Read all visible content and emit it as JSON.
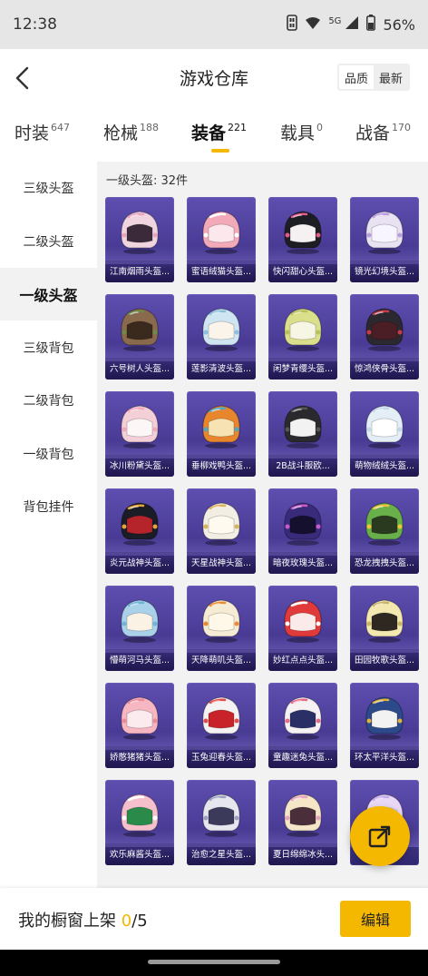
{
  "status_bar": {
    "time": "12:38",
    "network": "5G",
    "battery": "56%",
    "icons": [
      "sim-icon",
      "wifi-icon",
      "signal-icon",
      "battery-icon"
    ]
  },
  "nav": {
    "title": "游戏仓库",
    "sort_options": [
      "品质",
      "最新"
    ],
    "active_sort": "品质",
    "back_icon": "chevron-left-icon"
  },
  "tabs": [
    {
      "label": "时装",
      "count": "647"
    },
    {
      "label": "枪械",
      "count": "188"
    },
    {
      "label": "装备",
      "count": "221",
      "active": true
    },
    {
      "label": "载具",
      "count": "0"
    },
    {
      "label": "战备",
      "count": "170"
    }
  ],
  "sidebar": {
    "items": [
      "三级头盔",
      "二级头盔",
      "一级头盔",
      "三级背包",
      "二级背包",
      "一级背包",
      "背包挂件"
    ],
    "active_index": 2
  },
  "section": {
    "title": "一级头盔: 32件"
  },
  "items": [
    {
      "name": "江南烟雨头盔...",
      "colors": {
        "shell": "#f0d4e0",
        "visor": "#3b2a3a",
        "accent": "#e8a3c0"
      }
    },
    {
      "name": "蜜语绒猫头盔...",
      "colors": {
        "shell": "#f2a9b8",
        "visor": "#fbe7ec",
        "accent": "#ffffff"
      }
    },
    {
      "name": "快闪甜心头盔...",
      "colors": {
        "shell": "#1d1d24",
        "visor": "#f5f0f2",
        "accent": "#e45a8a"
      }
    },
    {
      "name": "镜光幻境头盔...",
      "colors": {
        "shell": "#e8e2f2",
        "visor": "#f7f5ff",
        "accent": "#b89be0"
      }
    },
    {
      "name": "六号树人头盔...",
      "colors": {
        "shell": "#8a6a4c",
        "visor": "#3a2a1e",
        "accent": "#6e8a4a"
      }
    },
    {
      "name": "莲影清波头盔...",
      "colors": {
        "shell": "#cfe6f2",
        "visor": "#fbf4ea",
        "accent": "#8cc0de"
      }
    },
    {
      "name": "闲梦青缨头盔...",
      "colors": {
        "shell": "#d9df8a",
        "visor": "#f7f6e4",
        "accent": "#b8c25c"
      }
    },
    {
      "name": "惊鸿侠骨头盔...",
      "colors": {
        "shell": "#2b2830",
        "visor": "#4a1e24",
        "accent": "#c83a4a"
      }
    },
    {
      "name": "冰川粉黛头盔...",
      "colors": {
        "shell": "#f3d0d8",
        "visor": "#fdf6f7",
        "accent": "#f0a9bd"
      }
    },
    {
      "name": "垂柳戏鸭头盔...",
      "colors": {
        "shell": "#e8862e",
        "visor": "#f6e2b2",
        "accent": "#4fa8c8"
      }
    },
    {
      "name": "2B战斗服欧...",
      "colors": {
        "shell": "#2a2a2e",
        "visor": "#f2f2f2",
        "accent": "#555"
      }
    },
    {
      "name": "萌物绒绒头盔...",
      "colors": {
        "shell": "#e4eef6",
        "visor": "#ffffff",
        "accent": "#c3d8ea"
      }
    },
    {
      "name": "炎元战神头盔...",
      "colors": {
        "shell": "#1a1d26",
        "visor": "#b5242a",
        "accent": "#e2a53a"
      }
    },
    {
      "name": "天星战神头盔...",
      "colors": {
        "shell": "#f3eee4",
        "visor": "#fffaf0",
        "accent": "#d9b25a"
      }
    },
    {
      "name": "暗夜玫瑰头盔...",
      "colors": {
        "shell": "#3a2a7a",
        "visor": "#15102e",
        "accent": "#c95ac8"
      }
    },
    {
      "name": "恐龙拽拽头盔...",
      "colors": {
        "shell": "#6ab04a",
        "visor": "#2a3a1e",
        "accent": "#f2c33a"
      }
    },
    {
      "name": "懵萌河马头盔...",
      "colors": {
        "shell": "#a9d2ea",
        "visor": "#fbf2e6",
        "accent": "#6fb3d8"
      }
    },
    {
      "name": "天降萌叽头盔...",
      "colors": {
        "shell": "#f6ecd6",
        "visor": "#fff8e8",
        "accent": "#ef8a2e"
      }
    },
    {
      "name": "妙红点点头盔...",
      "colors": {
        "shell": "#e13a3a",
        "visor": "#fbeaea",
        "accent": "#ffffff"
      }
    },
    {
      "name": "田园牧歌头盔...",
      "colors": {
        "shell": "#f2e8b0",
        "visor": "#2e2820",
        "accent": "#c9b46a"
      }
    },
    {
      "name": "娇憨猪猪头盔...",
      "colors": {
        "shell": "#f6b6c2",
        "visor": "#fcebee",
        "accent": "#e9899c"
      }
    },
    {
      "name": "玉兔迎春头盔...",
      "colors": {
        "shell": "#f4f2f2",
        "visor": "#c8232a",
        "accent": "#e84a4a"
      }
    },
    {
      "name": "童趣迷兔头盔...",
      "colors": {
        "shell": "#f6f2f4",
        "visor": "#2a2f66",
        "accent": "#e66a8a"
      }
    },
    {
      "name": "环太平洋头盔...",
      "colors": {
        "shell": "#2c4a8a",
        "visor": "#f2f2f2",
        "accent": "#e2b23a"
      }
    },
    {
      "name": "欢乐麻酱头盔...",
      "colors": {
        "shell": "#f5c0cc",
        "visor": "#2a8a4a",
        "accent": "#ffffff"
      }
    },
    {
      "name": "治愈之星头盔...",
      "colors": {
        "shell": "#e6e6ee",
        "visor": "#3c3a5a",
        "accent": "#9aa2c0"
      }
    },
    {
      "name": "夏日绵绵冰头...",
      "colors": {
        "shell": "#f5e6c8",
        "visor": "#4a2e3a",
        "accent": "#e7a3bd"
      }
    },
    {
      "name": "",
      "colors": {
        "shell": "#e8d8f6",
        "visor": "#f8f2ff",
        "accent": "#c6a9ee"
      }
    }
  ],
  "fab": {
    "icon": "open-external-icon"
  },
  "bottom": {
    "shelf_label": "我的橱窗上架",
    "shelf_current": "0",
    "shelf_total": "/5",
    "edit_label": "编辑"
  }
}
